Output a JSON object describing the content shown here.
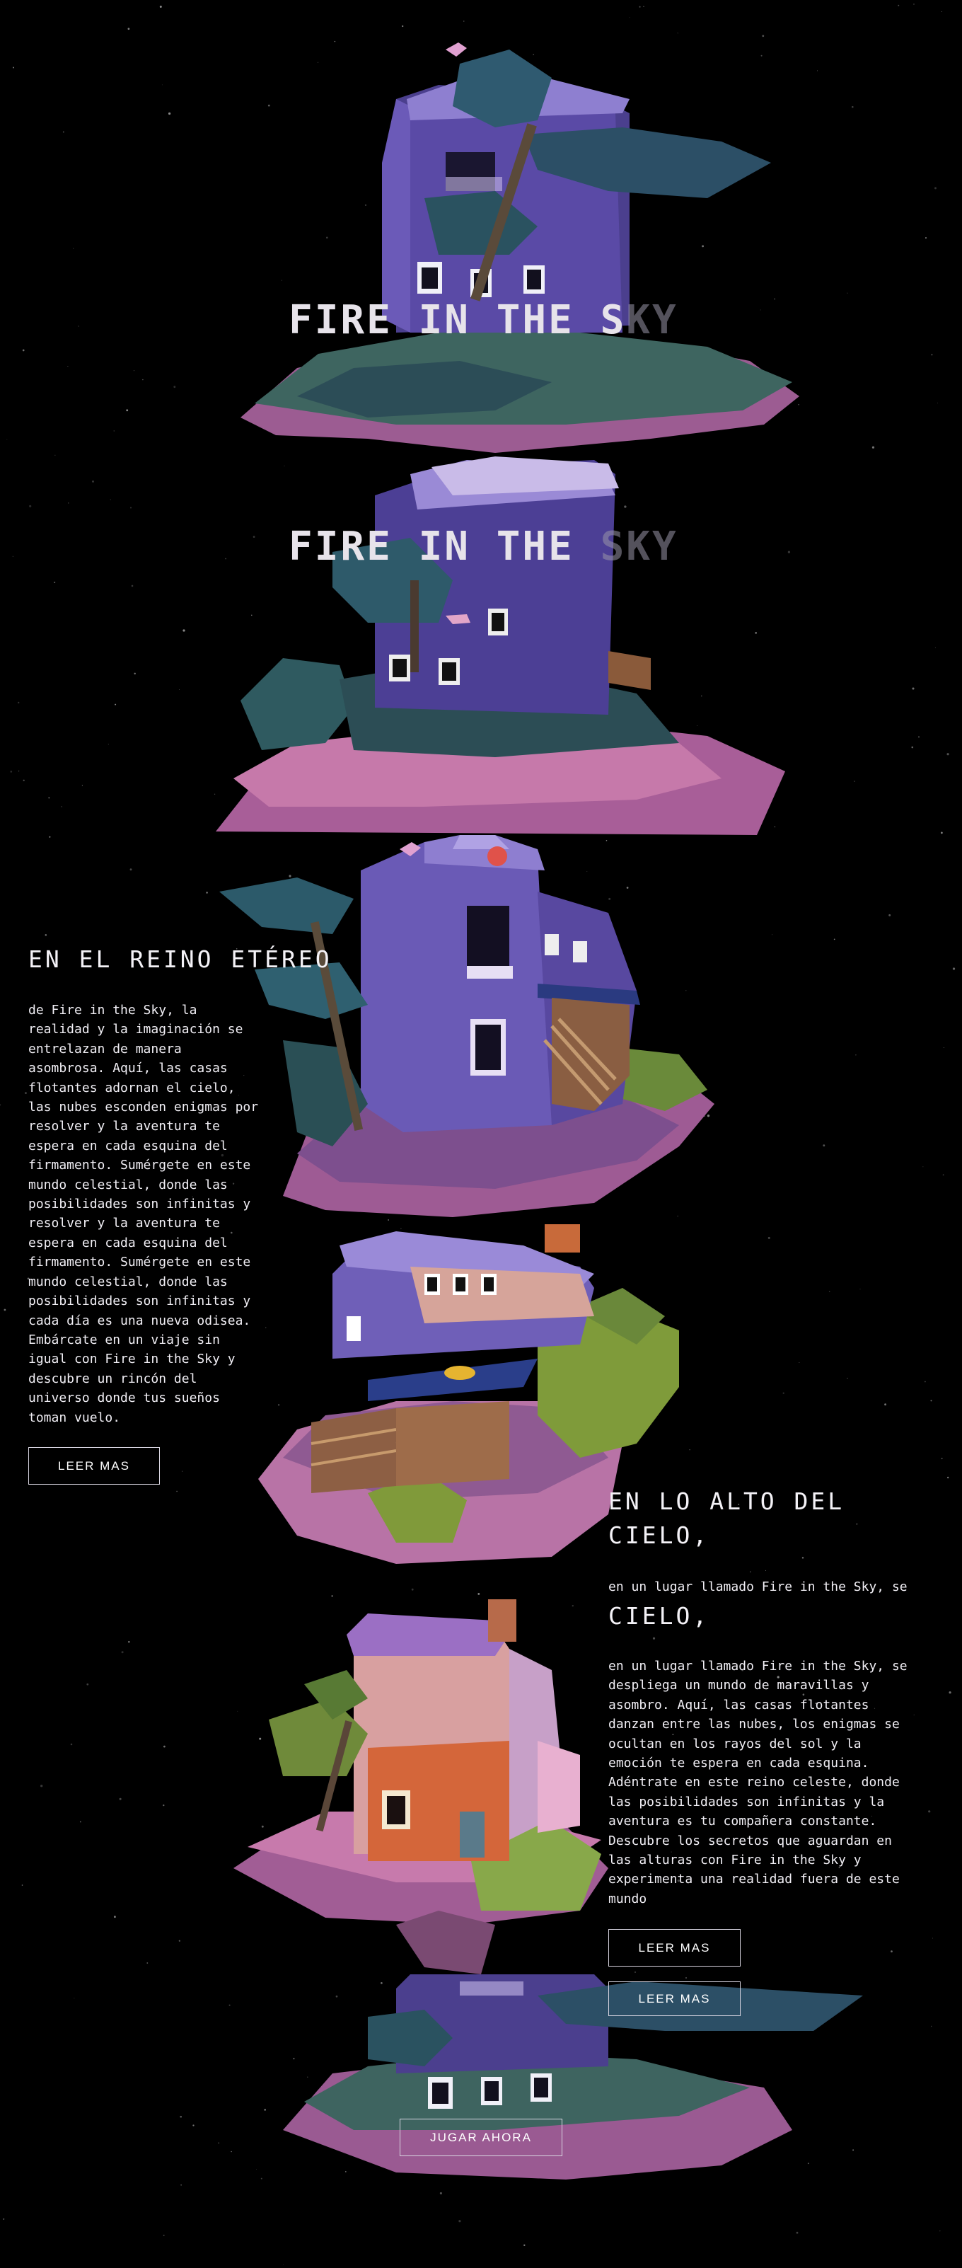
{
  "hero": {
    "title_main": "FIRE IN THE S",
    "title_fade": "KY",
    "title2_main": "FIRE IN THE ",
    "title2_fade": "SKY"
  },
  "section_ethereal": {
    "heading": "EN EL REINO ETÉREO",
    "paragraph_lines": [
      "de Fire in the Sky, la",
      "realidad y la imaginación se",
      "entrelazan de manera",
      "asombrosa. Aquí, las casas",
      "flotantes adornan el cielo,",
      "las nubes esconden enigmas por",
      "resolver y la aventura te",
      "espera en cada esquina del",
      "firmamento. Sumérgete en este",
      "mundo celestial, donde las",
      "posibilidades son infinitas y",
      "resolver y la aventura te",
      "espera en cada esquina del",
      "firmamento. Sumérgete en este",
      "mundo celestial, donde las",
      "posibilidades son infinitas y",
      "cada día es una nueva odisea.",
      "Embárcate en un viaje sin",
      "igual con Fire in the Sky y",
      "descubre un rincón del",
      "universo donde tus sueños",
      "toman vuelo."
    ],
    "button": "LEER MAS"
  },
  "section_sky": {
    "heading_line1": "EN LO ALTO DEL",
    "heading_line2": "CIELO,",
    "intro_line": "en un lugar llamado Fire in the Sky, se",
    "heading_repeat": "CIELO,",
    "paragraph_lines": [
      "en un lugar llamado Fire in the Sky, se",
      "despliega un mundo de maravillas y",
      "asombro. Aquí, las casas flotantes",
      "danzan entre las nubes, los enigmas se",
      "ocultan en los rayos del sol y la",
      "emoción te espera en cada esquina.",
      "Adéntrate en este reino celeste, donde",
      "las posibilidades son infinitas y la",
      "aventura es tu compañera constante.",
      "Descubre los secretos que aguardan en",
      "las alturas con Fire in the Sky y",
      "experimenta una realidad fuera de este",
      "mundo"
    ],
    "button": "LEER MAS",
    "button_repeat": "LEER MAS"
  },
  "footer": {
    "play_button": "JUGAR AHORA"
  },
  "colors": {
    "background": "#000000",
    "house_purple": "#6c58b8",
    "house_dark": "#3a2f78",
    "island_pink": "#b06aa0",
    "tree_teal": "#2f5f6a",
    "grass_green": "#7a9a3a",
    "brick_orange": "#d4663a",
    "roof_pink": "#e89ab8"
  },
  "icons": [
    "bird-icon"
  ]
}
